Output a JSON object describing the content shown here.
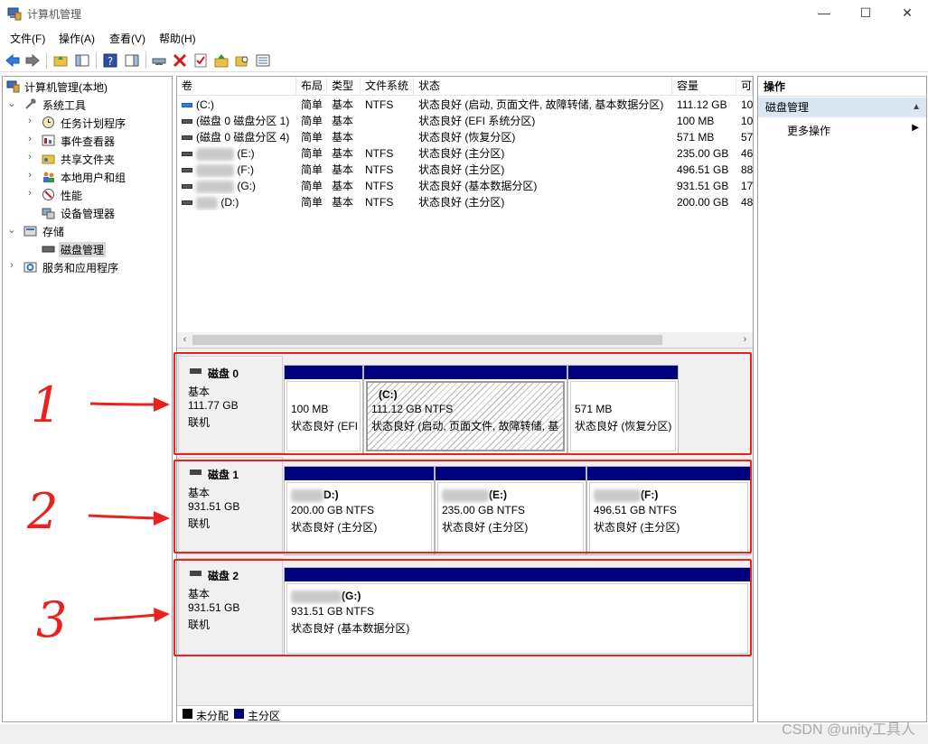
{
  "window": {
    "title": "计算机管理",
    "minimize": "—",
    "maximize": "☐",
    "close": "✕"
  },
  "menu": [
    "文件(F)",
    "操作(A)",
    "查看(V)",
    "帮助(H)"
  ],
  "tree": {
    "root": "计算机管理(本地)",
    "system_tools": "系统工具",
    "task_scheduler": "任务计划程序",
    "event_viewer": "事件查看器",
    "shared_folders": "共享文件夹",
    "local_users": "本地用户和组",
    "performance": "性能",
    "device_manager": "设备管理器",
    "storage": "存储",
    "disk_management": "磁盘管理",
    "services": "服务和应用程序"
  },
  "columns": [
    "卷",
    "布局",
    "类型",
    "文件系统",
    "状态",
    "容量",
    "可"
  ],
  "volumes": [
    {
      "name": "(C:)",
      "layout": "简单",
      "type": "基本",
      "fs": "NTFS",
      "status": "状态良好 (启动, 页面文件, 故障转储, 基本数据分区)",
      "capacity": "111.12 GB",
      "free": "10"
    },
    {
      "name": "(磁盘 0 磁盘分区 1)",
      "layout": "简单",
      "type": "基本",
      "fs": "",
      "status": "状态良好 (EFI 系统分区)",
      "capacity": "100 MB",
      "free": "10"
    },
    {
      "name": "(磁盘 0 磁盘分区 4)",
      "layout": "简单",
      "type": "基本",
      "fs": "",
      "status": "状态良好 (恢复分区)",
      "capacity": "571 MB",
      "free": "57"
    },
    {
      "name": "(E:)",
      "layout": "简单",
      "type": "基本",
      "fs": "NTFS",
      "status": "状态良好 (主分区)",
      "capacity": "235.00 GB",
      "free": "46"
    },
    {
      "name": "(F:)",
      "layout": "简单",
      "type": "基本",
      "fs": "NTFS",
      "status": "状态良好 (主分区)",
      "capacity": "496.51 GB",
      "free": "88"
    },
    {
      "name": "(G:)",
      "layout": "简单",
      "type": "基本",
      "fs": "NTFS",
      "status": "状态良好 (基本数据分区)",
      "capacity": "931.51 GB",
      "free": "17"
    },
    {
      "name": "(D:)",
      "layout": "简单",
      "type": "基本",
      "fs": "NTFS",
      "status": "状态良好 (主分区)",
      "capacity": "200.00 GB",
      "free": "48"
    }
  ],
  "disks": [
    {
      "name": "磁盘 0",
      "type": "基本",
      "size": "111.77 GB",
      "state": "联机",
      "partitions": [
        {
          "label": "",
          "size": "100 MB",
          "status": "状态良好 (EFI"
        },
        {
          "label": "(C:)",
          "size": "111.12 GB NTFS",
          "status": "状态良好 (启动, 页面文件, 故障转储, 基"
        },
        {
          "label": "",
          "size": "571 MB",
          "status": "状态良好 (恢复分区)"
        }
      ]
    },
    {
      "name": "磁盘 1",
      "type": "基本",
      "size": "931.51 GB",
      "state": "联机",
      "partitions": [
        {
          "label": "D:)",
          "size": "200.00 GB NTFS",
          "status": "状态良好 (主分区)"
        },
        {
          "label": "(E:)",
          "size": "235.00 GB NTFS",
          "status": "状态良好 (主分区)"
        },
        {
          "label": "(F:)",
          "size": "496.51 GB NTFS",
          "status": "状态良好 (主分区)"
        }
      ]
    },
    {
      "name": "磁盘 2",
      "type": "基本",
      "size": "931.51 GB",
      "state": "联机",
      "partitions": [
        {
          "label": "(G:)",
          "size": "931.51 GB NTFS",
          "status": "状态良好 (基本数据分区)"
        }
      ]
    }
  ],
  "legend": {
    "unallocated": "未分配",
    "primary": "主分区",
    "unallocated_color": "#000000",
    "primary_color": "#00007f"
  },
  "actions": {
    "header": "操作",
    "section": "磁盘管理",
    "more": "更多操作"
  },
  "annotations": [
    "1",
    "2",
    "3"
  ],
  "watermark": "CSDN @unity工具人",
  "colors": {
    "partition_bar": "#00007f",
    "highlight_box": "#e8231f",
    "selection": "#dbe6f3"
  }
}
